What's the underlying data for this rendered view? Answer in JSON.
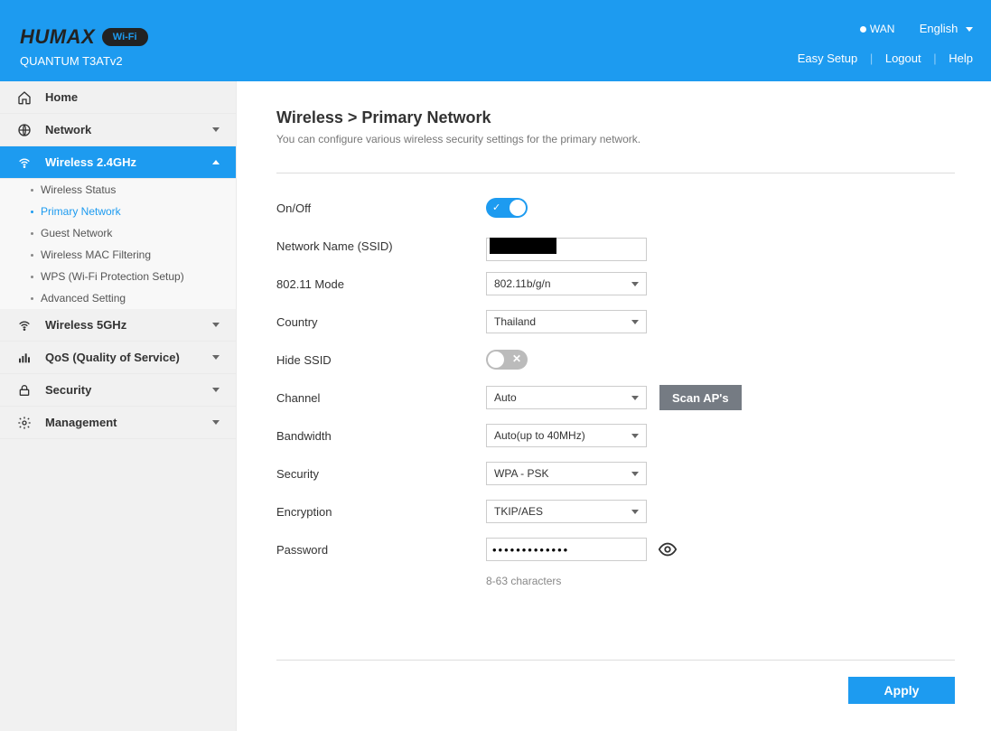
{
  "header": {
    "brand": "HUMAX",
    "badge": "Wi-Fi",
    "model": "QUANTUM T3ATv2",
    "wan_label": "WAN",
    "language": "English",
    "easy_setup": "Easy Setup",
    "logout": "Logout",
    "help": "Help"
  },
  "sidebar": {
    "home": "Home",
    "network": "Network",
    "wireless24": "Wireless 2.4GHz",
    "sub": {
      "status": "Wireless Status",
      "primary": "Primary Network",
      "guest": "Guest Network",
      "mac": "Wireless MAC Filtering",
      "wps": "WPS (Wi-Fi Protection Setup)",
      "advanced": "Advanced Setting"
    },
    "wireless5": "Wireless 5GHz",
    "qos": "QoS (Quality of Service)",
    "security": "Security",
    "management": "Management"
  },
  "page": {
    "title": "Wireless > Primary Network",
    "desc": "You can configure various wireless security settings for the primary network."
  },
  "form": {
    "onoff_label": "On/Off",
    "onoff_value": true,
    "ssid_label": "Network Name (SSID)",
    "ssid_value": "",
    "mode_label": "802.11 Mode",
    "mode_value": "802.11b/g/n",
    "country_label": "Country",
    "country_value": "Thailand",
    "hide_label": "Hide SSID",
    "hide_value": false,
    "channel_label": "Channel",
    "channel_value": "Auto",
    "scan_btn": "Scan AP's",
    "bandwidth_label": "Bandwidth",
    "bandwidth_value": "Auto(up to 40MHz)",
    "security_label": "Security",
    "security_value": "WPA - PSK",
    "encryption_label": "Encryption",
    "encryption_value": "TKIP/AES",
    "password_label": "Password",
    "password_value": "•••••••••••••",
    "password_hint": "8-63 characters"
  },
  "actions": {
    "apply": "Apply"
  }
}
